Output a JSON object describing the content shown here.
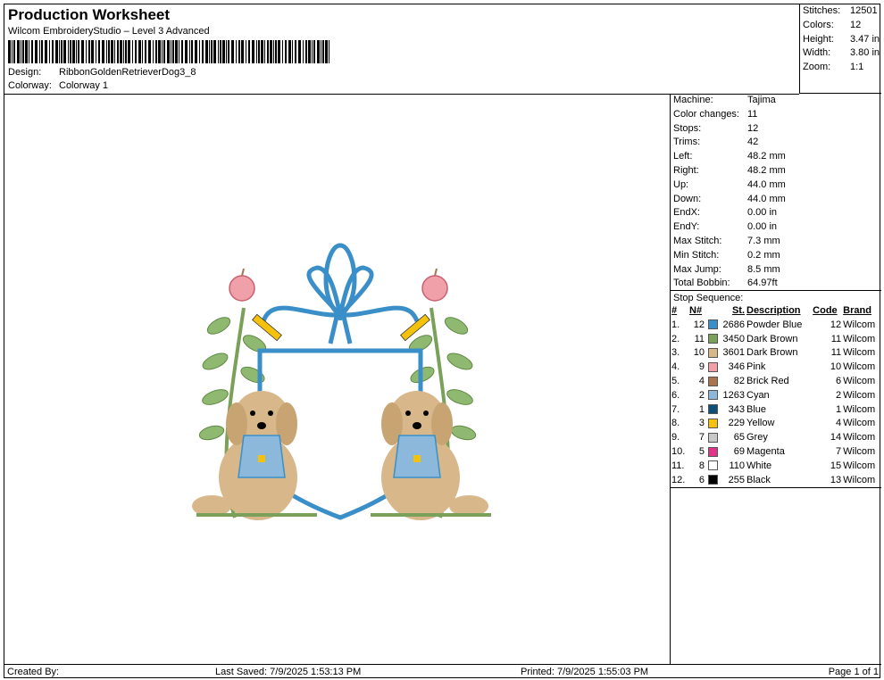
{
  "header": {
    "title": "Production Worksheet",
    "subtitle": "Wilcom EmbroideryStudio – Level 3 Advanced",
    "design_label": "Design:",
    "design_value": "RibbonGoldenRetrieverDog3_8",
    "colorway_label": "Colorway:",
    "colorway_value": "Colorway 1"
  },
  "stats": [
    {
      "k": "Stitches:",
      "v": "12501"
    },
    {
      "k": "Colors:",
      "v": "12"
    },
    {
      "k": "Height:",
      "v": "3.47 in"
    },
    {
      "k": "Width:",
      "v": "3.80 in"
    },
    {
      "k": "Zoom:",
      "v": "1:1"
    }
  ],
  "info": [
    {
      "k": "Machine:",
      "v": "Tajima"
    },
    {
      "k": "Color changes:",
      "v": "11"
    },
    {
      "k": "Stops:",
      "v": "12"
    },
    {
      "k": "Trims:",
      "v": "42"
    },
    {
      "k": "Left:",
      "v": "48.2 mm"
    },
    {
      "k": "Right:",
      "v": "48.2 mm"
    },
    {
      "k": "Up:",
      "v": "44.0 mm"
    },
    {
      "k": "Down:",
      "v": "44.0 mm"
    },
    {
      "k": "EndX:",
      "v": "0.00 in"
    },
    {
      "k": "EndY:",
      "v": "0.00 in"
    },
    {
      "k": "Max Stitch:",
      "v": "7.3 mm"
    },
    {
      "k": "Min Stitch:",
      "v": "0.2 mm"
    },
    {
      "k": "Max Jump:",
      "v": "8.5 mm"
    },
    {
      "k": "Total Bobbin:",
      "v": "64.97ft"
    }
  ],
  "sequence": {
    "title": "Stop Sequence:",
    "headers": [
      "#",
      "N#",
      "St.",
      "Description",
      "Code",
      "Brand"
    ],
    "rows": [
      {
        "idx": "1.",
        "n": "12",
        "color": "#3a8fc9",
        "st": "2686",
        "desc": "Powder Blue",
        "code": "12",
        "brand": "Wilcom"
      },
      {
        "idx": "2.",
        "n": "11",
        "color": "#7aa05a",
        "st": "3450",
        "desc": "Dark Brown",
        "code": "11",
        "brand": "Wilcom"
      },
      {
        "idx": "3.",
        "n": "10",
        "color": "#d8b88a",
        "st": "3601",
        "desc": "Dark Brown",
        "code": "11",
        "brand": "Wilcom"
      },
      {
        "idx": "4.",
        "n": "9",
        "color": "#f0a0a8",
        "st": "346",
        "desc": "Pink",
        "code": "10",
        "brand": "Wilcom"
      },
      {
        "idx": "5.",
        "n": "4",
        "color": "#a97550",
        "st": "82",
        "desc": "Brick Red",
        "code": "6",
        "brand": "Wilcom"
      },
      {
        "idx": "6.",
        "n": "2",
        "color": "#8cb8dc",
        "st": "1263",
        "desc": "Cyan",
        "code": "2",
        "brand": "Wilcom"
      },
      {
        "idx": "7.",
        "n": "1",
        "color": "#0e4f78",
        "st": "343",
        "desc": "Blue",
        "code": "1",
        "brand": "Wilcom"
      },
      {
        "idx": "8.",
        "n": "3",
        "color": "#f4c20d",
        "st": "229",
        "desc": "Yellow",
        "code": "4",
        "brand": "Wilcom"
      },
      {
        "idx": "9.",
        "n": "7",
        "color": "#c8c8c8",
        "st": "65",
        "desc": "Grey",
        "code": "14",
        "brand": "Wilcom"
      },
      {
        "idx": "10.",
        "n": "5",
        "color": "#e0338a",
        "st": "69",
        "desc": "Magenta",
        "code": "7",
        "brand": "Wilcom"
      },
      {
        "idx": "11.",
        "n": "8",
        "color": "#ffffff",
        "st": "110",
        "desc": "White",
        "code": "15",
        "brand": "Wilcom"
      },
      {
        "idx": "12.",
        "n": "6",
        "color": "#000000",
        "st": "255",
        "desc": "Black",
        "code": "13",
        "brand": "Wilcom"
      }
    ]
  },
  "footer": {
    "created_by": "Created By:",
    "last_saved": "Last Saved: 7/9/2025 1:53:13 PM",
    "printed": "Printed: 7/9/2025 1:55:03 PM",
    "page": "Page 1 of 1"
  }
}
